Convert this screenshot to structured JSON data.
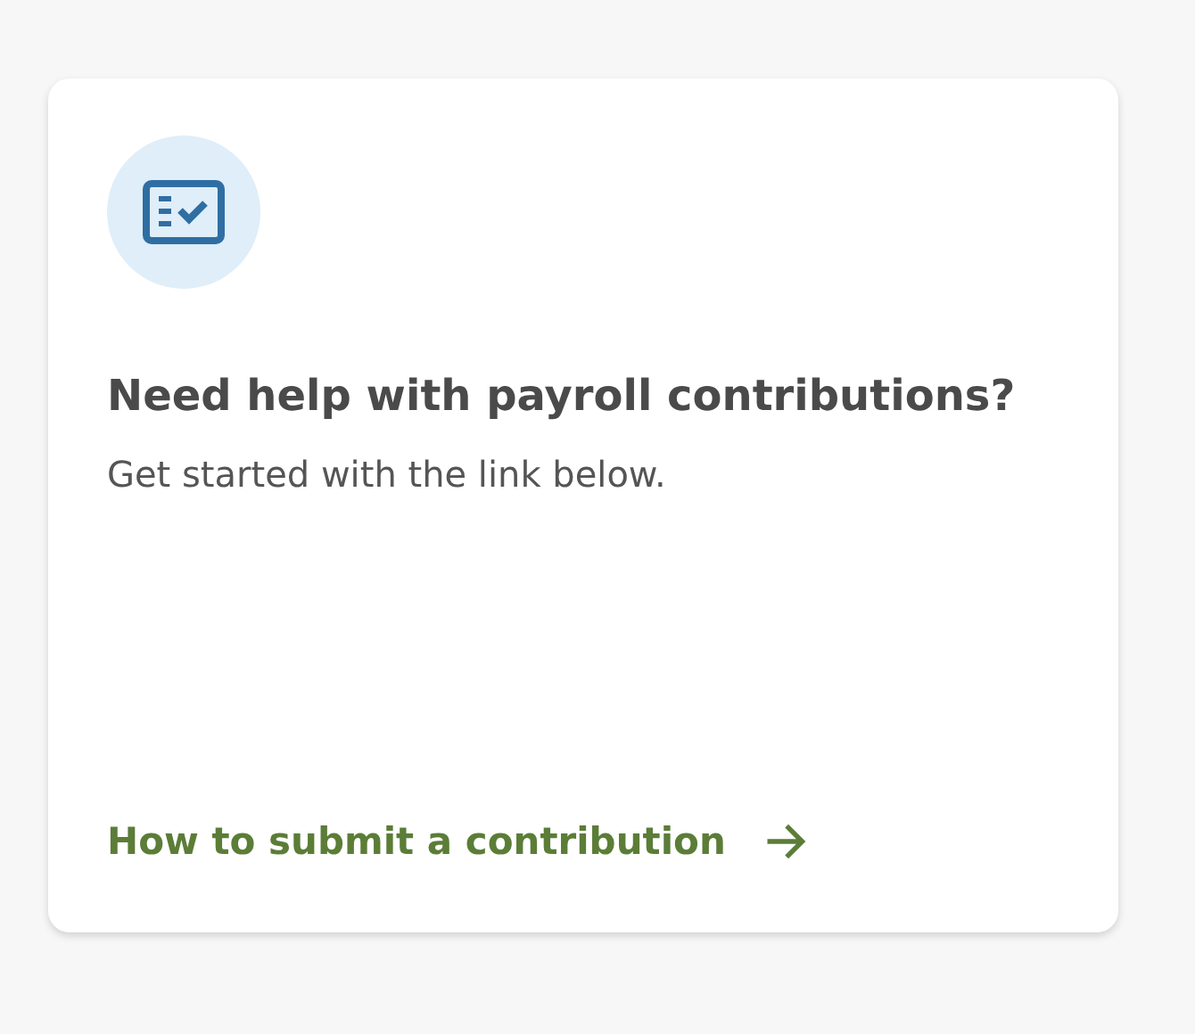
{
  "card": {
    "title": "Need help with payroll contributions?",
    "description": "Get started with the link below.",
    "link": {
      "label": "How to submit a contribution"
    }
  }
}
